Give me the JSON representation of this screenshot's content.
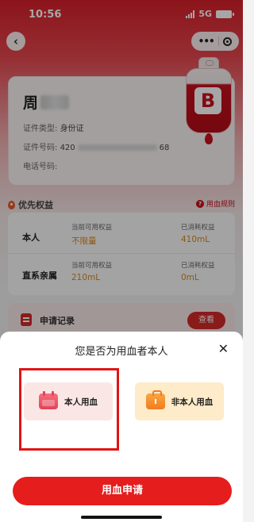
{
  "status_bar": {
    "time": "10:56",
    "network": "5G"
  },
  "nav": {
    "back_icon": "back-arrow-icon",
    "menu_icon": "more-dots-icon",
    "close_icon": "target-icon"
  },
  "user": {
    "name_visible": "周",
    "id_type_label": "证件类型:",
    "id_type_value": "身份证",
    "id_number_label": "证件号码:",
    "id_number_prefix": "420",
    "id_number_suffix": "68",
    "phone_label": "电话号码:",
    "blood_type": "B"
  },
  "priority": {
    "title": "优先权益",
    "rules_link": "用血规则",
    "rows": [
      {
        "who": "本人",
        "available_label": "当前可用权益",
        "available_value": "不限量",
        "consumed_label": "已消耗权益",
        "consumed_value": "410mL"
      },
      {
        "who": "直系亲属",
        "available_label": "当前可用权益",
        "available_value": "210mL",
        "consumed_label": "已消耗权益",
        "consumed_value": "0mL"
      }
    ]
  },
  "records": {
    "title": "申请记录",
    "view_button": "查看"
  },
  "sheet": {
    "title": "您是否为用血者本人",
    "close": "✕",
    "option_self": "本人用血",
    "option_other": "非本人用血",
    "apply_button": "用血申请"
  },
  "colors": {
    "brand_red": "#e61d1d",
    "accent_orange": "#d8891f"
  }
}
